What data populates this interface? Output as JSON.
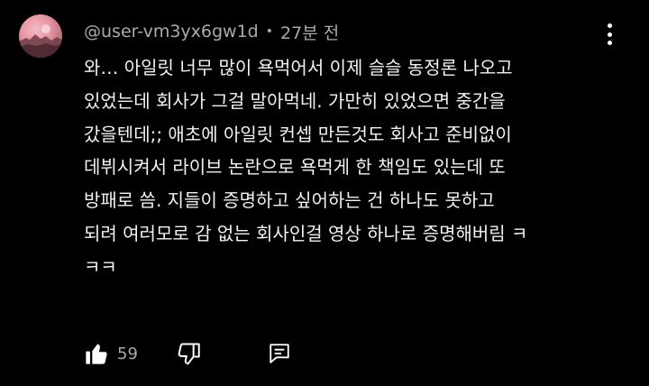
{
  "comment": {
    "avatar_icon": "profile-avatar",
    "author": "@user-vm3yx6gw1d",
    "separator": "•",
    "timestamp": "27분 전",
    "menu_icon": "more-vert-icon",
    "text_lines": [
      "와… 아일릿 너무 많이 욕먹어서 이제 슬슬 동정론 나오고",
      "있었는데 회사가 그걸 말아먹네. 가만히 있었으면 중간을",
      "갔을텐데;; 애초에 아일릿 컨셉 만든것도 회사고 준비없이",
      "데뷔시켜서 라이브 논란으로 욕먹게 한 책임도 있는데 또",
      "방패로 씀. 지들이 증명하고 싶어하는 건 하나도 못하고",
      "되려 여러모로 감 없는 회사인걸 영상 하나로 증명해버림 ㅋ",
      "ㅋㅋ"
    ],
    "actions": {
      "like_icon": "thumb-up-icon",
      "like_count": "59",
      "dislike_icon": "thumb-down-icon",
      "reply_icon": "reply-comment-icon"
    }
  },
  "colors": {
    "background": "#000000",
    "text_primary": "#f1f1f1",
    "text_secondary": "#aaaaaa",
    "icon": "#ffffff"
  }
}
